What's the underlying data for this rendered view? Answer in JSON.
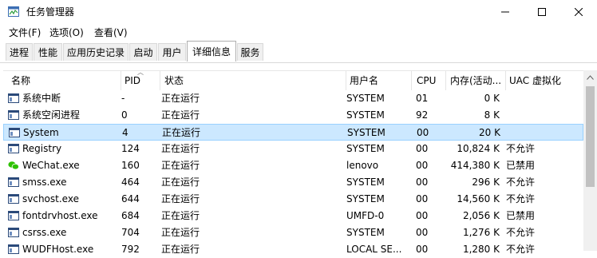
{
  "window": {
    "title": "任务管理器"
  },
  "menu": {
    "file": "文件(F)",
    "options": "选项(O)",
    "view": "查看(V)"
  },
  "tabs": [
    "进程",
    "性能",
    "应用历史记录",
    "启动",
    "用户",
    "详细信息",
    "服务"
  ],
  "active_tab": "详细信息",
  "columns": {
    "name": "名称",
    "pid": "PID",
    "status": "状态",
    "user": "用户名",
    "cpu": "CPU",
    "memory": "内存(活动...",
    "uac": "UAC 虚拟化"
  },
  "rows": [
    {
      "name": "系统中断",
      "pid": "-",
      "status": "正在运行",
      "user": "SYSTEM",
      "cpu": "01",
      "mem": "0 K",
      "uac": "",
      "icon": "window-icon"
    },
    {
      "name": "系统空闲进程",
      "pid": "0",
      "status": "正在运行",
      "user": "SYSTEM",
      "cpu": "92",
      "mem": "8 K",
      "uac": "",
      "icon": "window-icon"
    },
    {
      "name": "System",
      "pid": "4",
      "status": "正在运行",
      "user": "SYSTEM",
      "cpu": "00",
      "mem": "20 K",
      "uac": "",
      "icon": "window-icon"
    },
    {
      "name": "Registry",
      "pid": "124",
      "status": "正在运行",
      "user": "SYSTEM",
      "cpu": "00",
      "mem": "10,824 K",
      "uac": "不允许",
      "icon": "window-icon"
    },
    {
      "name": "WeChat.exe",
      "pid": "160",
      "status": "正在运行",
      "user": "lenovo",
      "cpu": "00",
      "mem": "414,380 K",
      "uac": "已禁用",
      "icon": "wechat-icon"
    },
    {
      "name": "smss.exe",
      "pid": "464",
      "status": "正在运行",
      "user": "SYSTEM",
      "cpu": "00",
      "mem": "296 K",
      "uac": "不允许",
      "icon": "window-icon"
    },
    {
      "name": "svchost.exe",
      "pid": "644",
      "status": "正在运行",
      "user": "SYSTEM",
      "cpu": "00",
      "mem": "14,560 K",
      "uac": "不允许",
      "icon": "window-icon"
    },
    {
      "name": "fontdrvhost.exe",
      "pid": "684",
      "status": "正在运行",
      "user": "UMFD-0",
      "cpu": "00",
      "mem": "2,056 K",
      "uac": "已禁用",
      "icon": "window-icon"
    },
    {
      "name": "csrss.exe",
      "pid": "704",
      "status": "正在运行",
      "user": "SYSTEM",
      "cpu": "00",
      "mem": "1,276 K",
      "uac": "不允许",
      "icon": "window-icon"
    },
    {
      "name": "WUDFHost.exe",
      "pid": "792",
      "status": "正在运行",
      "user": "LOCAL SE...",
      "cpu": "00",
      "mem": "1,280 K",
      "uac": "不允许",
      "icon": "window-icon"
    }
  ],
  "selected_row": "System",
  "colors": {
    "selection_bg": "#cce8ff",
    "selection_border": "#99d1ff",
    "wechat_green": "#2dc100"
  }
}
